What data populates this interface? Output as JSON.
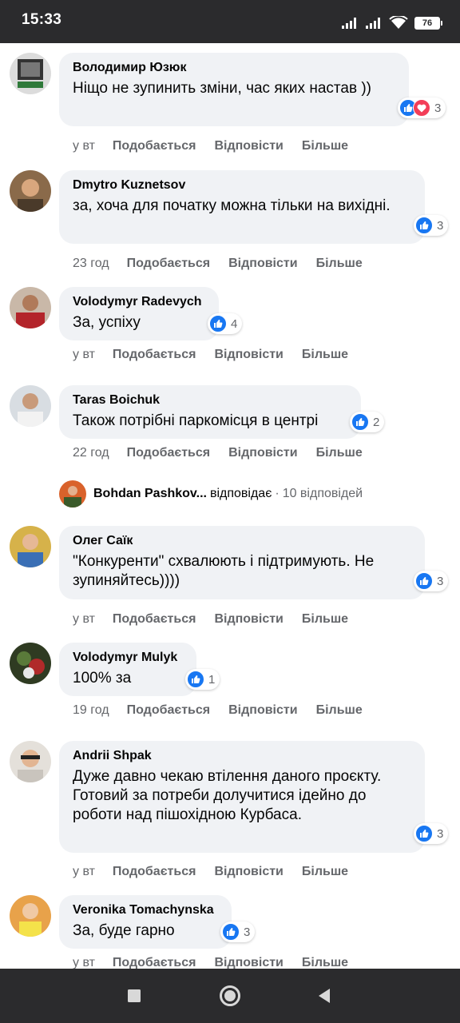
{
  "status": {
    "time": "15:33",
    "battery": "76"
  },
  "actions": {
    "like": "Подобається",
    "reply": "Відповісти",
    "more": "Більше"
  },
  "comments": [
    {
      "author": "Володимир Юзюк",
      "text": "Ніщо не зупинить зміни, час яких настав ))",
      "reactions": "3",
      "time": "у вт"
    },
    {
      "author": "Dmytro Kuznetsov",
      "text": "за, хоча для початку можна тільки на вихідні.",
      "reactions": "3",
      "time": "23 год"
    },
    {
      "author": "Volodymyr Radevych",
      "text": "За, успіху",
      "reactions": "4",
      "time": "у вт"
    },
    {
      "author": "Taras Boichuk",
      "text": "Також потрібні паркомісця в центрі",
      "reactions": "2",
      "time": "22 год"
    },
    {
      "author": "Олег Саїк",
      "text": "\"Конкуренти\" схвалюють і підтримують. Не зупиняйтесь))))",
      "reactions": "3",
      "time": "у вт"
    },
    {
      "author": "Volodymyr Mulyk",
      "text": "100% за",
      "reactions": "1",
      "time": "19 год"
    },
    {
      "author": "Andrii Shpak",
      "text": "Дуже давно чекаю втілення даного проєкту.\nГотовий за потреби долучитися ідейно до роботи над пішохідною Курбаса.",
      "reactions": "3",
      "time": "у вт"
    },
    {
      "author": "Veronika Tomachynska",
      "text": "За, буде гарно",
      "reactions": "3",
      "time": "у вт"
    }
  ],
  "thread": {
    "name": "Bohdan Pashkov...",
    "action": "відповідає",
    "separator": "·",
    "count": "10 відповідей"
  },
  "icons": {
    "like": "like-reaction-icon",
    "love": "love-reaction-icon",
    "signal": "signal-icon",
    "wifi": "wifi-icon",
    "battery": "battery-icon"
  },
  "colors": {
    "like": "#1877f2",
    "love": "#f33e58",
    "bubble": "#f0f2f5",
    "secondary": "#65676b",
    "system_bar": "#2b2b2d"
  }
}
